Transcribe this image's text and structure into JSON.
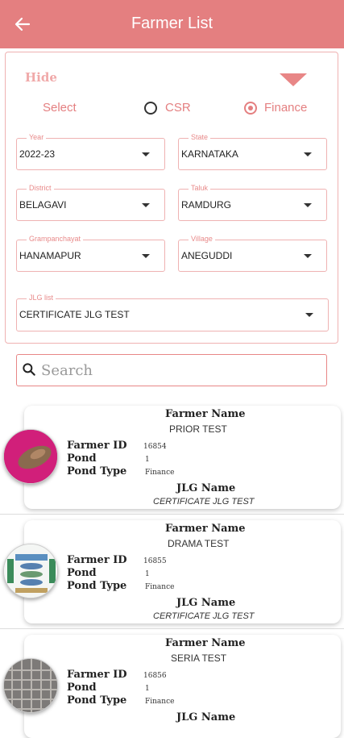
{
  "app": {
    "title": "Farmer List"
  },
  "filters": {
    "hide_label": "Hide",
    "select_label": "Select",
    "options": [
      "CSR",
      "Finance"
    ],
    "selected": "Finance",
    "year": {
      "label": "Year",
      "value": "2022-23"
    },
    "state": {
      "label": "State",
      "value": "KARNATAKA"
    },
    "district": {
      "label": "District",
      "value": "BELAGAVI"
    },
    "taluk": {
      "label": "Taluk",
      "value": "RAMDURG"
    },
    "grampanchayat": {
      "label": "Grampanchayat",
      "value": "HANAMAPUR"
    },
    "village": {
      "label": "Village",
      "value": "ANEGUDDI"
    },
    "jlg": {
      "label": "JLG list",
      "value": "CERTIFICATE JLG TEST"
    }
  },
  "search": {
    "placeholder": "Search"
  },
  "labels": {
    "farmer_name": "Farmer Name",
    "farmer_id": "Farmer ID",
    "pond": "Pond",
    "pond_type": "Pond Type",
    "jlg_name": "JLG Name"
  },
  "farmers": [
    {
      "name": "PRIOR TEST",
      "id": "16854",
      "pond": "1",
      "pond_type": "Finance",
      "jlg": "CERTIFICATE JLG TEST"
    },
    {
      "name": "DRAMA TEST",
      "id": "16855",
      "pond": "1",
      "pond_type": "Finance",
      "jlg": "CERTIFICATE JLG TEST"
    },
    {
      "name": "SERIA TEST",
      "id": "16856",
      "pond": "1",
      "pond_type": "Finance",
      "jlg": ""
    }
  ],
  "colors": {
    "accent": "#e47f80",
    "border": "#efb2b2"
  }
}
